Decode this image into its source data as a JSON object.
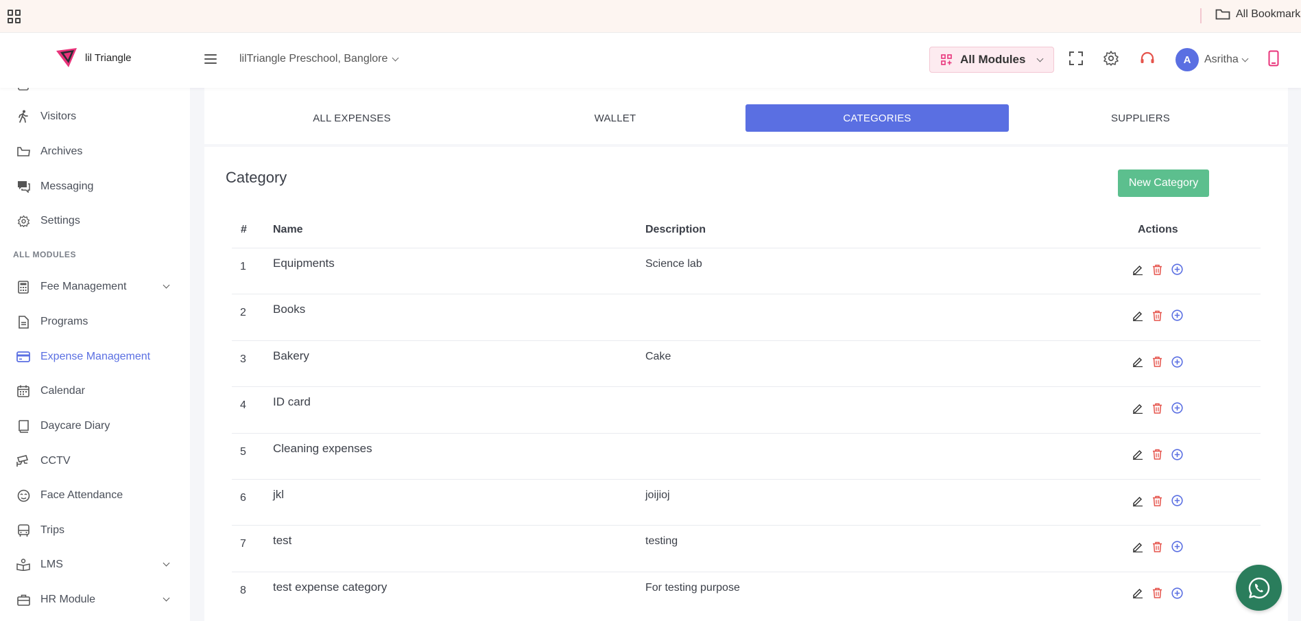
{
  "bookmarks_bar": {
    "folder_label": "All Bookmarks"
  },
  "header": {
    "logo_text": "lil Triangle",
    "school": "lilTriangle Preschool, Banglore",
    "modules_label": "All Modules",
    "user_initial": "A",
    "user_name": "Asritha"
  },
  "sidebar": {
    "items_top": [
      {
        "label": "Visitors",
        "icon": "walking-person-icon"
      },
      {
        "label": "Archives",
        "icon": "folder-icon"
      },
      {
        "label": "Messaging",
        "icon": "chat-icon"
      },
      {
        "label": "Settings",
        "icon": "gear-icon"
      }
    ],
    "section_label": "ALL MODULES",
    "items_modules": [
      {
        "label": "Fee Management",
        "icon": "calculator-icon",
        "dropdown": true
      },
      {
        "label": "Programs",
        "icon": "document-icon"
      },
      {
        "label": "Expense Management",
        "icon": "card-icon",
        "active": true
      },
      {
        "label": "Calendar",
        "icon": "calendar-icon"
      },
      {
        "label": "Daycare Diary",
        "icon": "book-icon"
      },
      {
        "label": "CCTV",
        "icon": "camera-icon"
      },
      {
        "label": "Face Attendance",
        "icon": "face-icon"
      },
      {
        "label": "Trips",
        "icon": "bus-icon"
      },
      {
        "label": "LMS",
        "icon": "reading-icon",
        "dropdown": true
      },
      {
        "label": "HR Module",
        "icon": "briefcase-icon",
        "dropdown": true
      }
    ]
  },
  "tabs": [
    {
      "label": "ALL EXPENSES"
    },
    {
      "label": "WALLET"
    },
    {
      "label": "CATEGORIES",
      "active": true
    },
    {
      "label": "SUPPLIERS"
    }
  ],
  "category": {
    "title": "Category",
    "new_button": "New Category",
    "columns": {
      "num": "#",
      "name": "Name",
      "description": "Description",
      "actions": "Actions"
    },
    "rows": [
      {
        "num": "1",
        "name": "Equipments",
        "description": "Science lab"
      },
      {
        "num": "2",
        "name": "Books",
        "description": ""
      },
      {
        "num": "3",
        "name": "Bakery",
        "description": "Cake"
      },
      {
        "num": "4",
        "name": "ID card",
        "description": ""
      },
      {
        "num": "5",
        "name": "Cleaning expenses",
        "description": ""
      },
      {
        "num": "6",
        "name": "jkl",
        "description": "joijioj"
      },
      {
        "num": "7",
        "name": "test",
        "description": "testing"
      },
      {
        "num": "8",
        "name": "test expense category",
        "description": "For testing purpose"
      }
    ]
  },
  "colors": {
    "accent": "#5a6fe2",
    "success": "#5cbf8e",
    "danger": "#e5534b",
    "whatsapp": "#2a7d5c"
  }
}
